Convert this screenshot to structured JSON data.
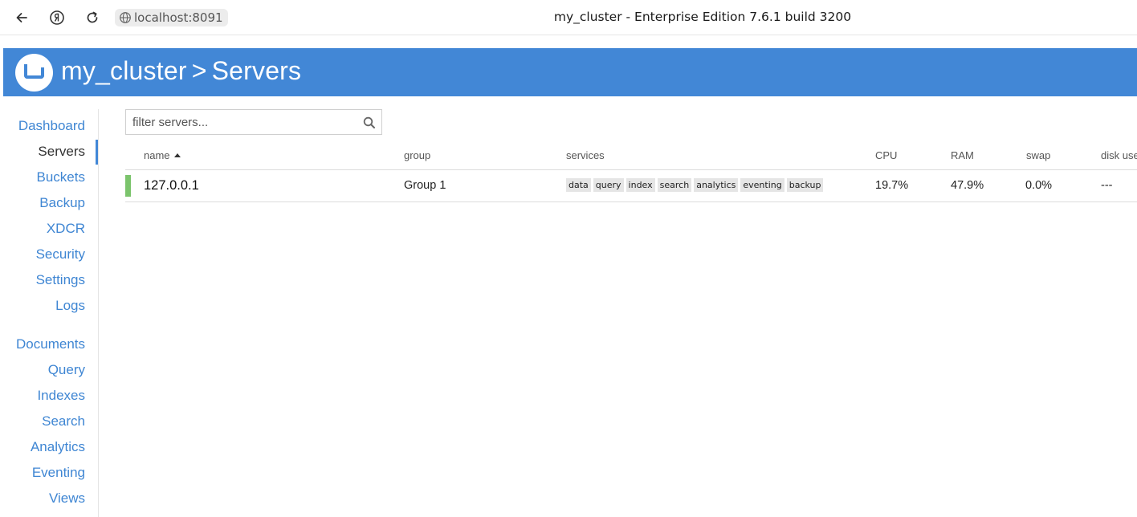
{
  "browser": {
    "url": "localhost:8091",
    "title": "my_cluster - Enterprise Edition 7.6.1 build 3200"
  },
  "header": {
    "cluster": "my_cluster",
    "separator": ">",
    "section": "Servers"
  },
  "sidebar": {
    "items": [
      {
        "label": "Dashboard",
        "active": false
      },
      {
        "label": "Servers",
        "active": true
      },
      {
        "label": "Buckets",
        "active": false
      },
      {
        "label": "Backup",
        "active": false
      },
      {
        "label": "XDCR",
        "active": false
      },
      {
        "label": "Security",
        "active": false
      },
      {
        "label": "Settings",
        "active": false
      },
      {
        "label": "Logs",
        "active": false
      },
      {
        "label": "Documents",
        "active": false
      },
      {
        "label": "Query",
        "active": false
      },
      {
        "label": "Indexes",
        "active": false
      },
      {
        "label": "Search",
        "active": false
      },
      {
        "label": "Analytics",
        "active": false
      },
      {
        "label": "Eventing",
        "active": false
      },
      {
        "label": "Views",
        "active": false
      }
    ]
  },
  "filter": {
    "placeholder": "filter servers...",
    "value": ""
  },
  "table": {
    "columns": [
      "name",
      "group",
      "services",
      "CPU",
      "RAM",
      "swap",
      "disk use"
    ],
    "sort_column": "name",
    "sort_direction": "ascending",
    "rows": [
      {
        "name": "127.0.0.1",
        "status_color": "#7bc46c",
        "group": "Group 1",
        "services": [
          "data",
          "query",
          "index",
          "search",
          "analytics",
          "eventing",
          "backup"
        ],
        "cpu": "19.7%",
        "ram": "47.9%",
        "swap": "0.0%",
        "disk_use": "---"
      }
    ]
  },
  "colors": {
    "brand_blue": "#4287d6",
    "link_blue": "#3f86d3",
    "status_green": "#7bc46c"
  }
}
